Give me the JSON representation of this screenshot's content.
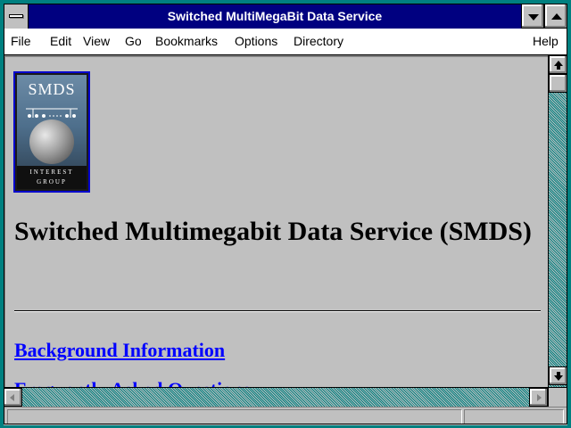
{
  "window": {
    "title": "Switched MultiMegaBit Data Service"
  },
  "menu": {
    "items": [
      {
        "label": "File"
      },
      {
        "label": "Edit"
      },
      {
        "label": "View"
      },
      {
        "label": "Go"
      },
      {
        "label": "Bookmarks"
      },
      {
        "label": "Options"
      },
      {
        "label": "Directory"
      },
      {
        "label": "Help"
      }
    ]
  },
  "page": {
    "logo": {
      "title": "SMDS",
      "band_line1": "INTEREST",
      "band_line2": "GROUP"
    },
    "heading": "Switched Multimegabit Data Service (SMDS)",
    "links": [
      {
        "label": "Background Information"
      },
      {
        "label": "Frequently Asked Questions"
      }
    ]
  },
  "status": {
    "text": ""
  },
  "colors": {
    "titlebar": "#000080",
    "link": "#0000ff",
    "frame": "#008080",
    "background": "#c0c0c0"
  },
  "icons": [
    "system-menu-icon",
    "minimize-icon",
    "maximize-icon",
    "scroll-up-icon",
    "scroll-down-icon",
    "scroll-left-icon",
    "scroll-right-icon"
  ]
}
